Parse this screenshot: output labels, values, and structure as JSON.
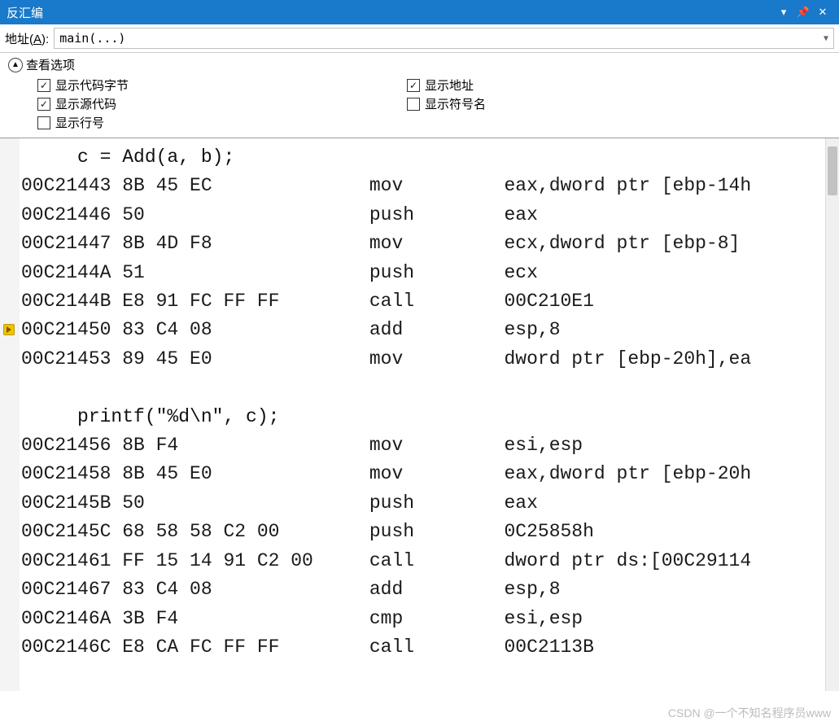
{
  "titlebar": {
    "title": "反汇编",
    "dropdown": "▾",
    "pin": "📌",
    "close": "✕"
  },
  "address_bar": {
    "label_prefix": "地址(",
    "label_accel": "A",
    "label_suffix": "):",
    "value": "main(...)"
  },
  "options": {
    "header": "查看选项",
    "left": [
      {
        "label": "显示代码字节",
        "checked": true
      },
      {
        "label": "显示源代码",
        "checked": true
      },
      {
        "label": "显示行号",
        "checked": false
      }
    ],
    "right": [
      {
        "label": "显示地址",
        "checked": true
      },
      {
        "label": "显示符号名",
        "checked": false
      }
    ]
  },
  "code": {
    "lines": [
      {
        "type": "src",
        "text": "     c = Add(a, b);"
      },
      {
        "type": "asm",
        "addr": "00C21443",
        "bytes": "8B 45 EC",
        "mnem": "mov",
        "ops": "eax,dword ptr [ebp-14h"
      },
      {
        "type": "asm",
        "addr": "00C21446",
        "bytes": "50",
        "mnem": "push",
        "ops": "eax"
      },
      {
        "type": "asm",
        "addr": "00C21447",
        "bytes": "8B 4D F8",
        "mnem": "mov",
        "ops": "ecx,dword ptr [ebp-8]"
      },
      {
        "type": "asm",
        "addr": "00C2144A",
        "bytes": "51",
        "mnem": "push",
        "ops": "ecx"
      },
      {
        "type": "asm",
        "addr": "00C2144B",
        "bytes": "E8 91 FC FF FF",
        "mnem": "call",
        "ops": "00C210E1"
      },
      {
        "type": "asm",
        "addr": "00C21450",
        "bytes": "83 C4 08",
        "mnem": "add",
        "ops": "esp,8",
        "current": true
      },
      {
        "type": "asm",
        "addr": "00C21453",
        "bytes": "89 45 E0",
        "mnem": "mov",
        "ops": "dword ptr [ebp-20h],ea"
      },
      {
        "type": "blank"
      },
      {
        "type": "src",
        "text": "     printf(\"%d\\n\", c);"
      },
      {
        "type": "asm",
        "addr": "00C21456",
        "bytes": "8B F4",
        "mnem": "mov",
        "ops": "esi,esp"
      },
      {
        "type": "asm",
        "addr": "00C21458",
        "bytes": "8B 45 E0",
        "mnem": "mov",
        "ops": "eax,dword ptr [ebp-20h"
      },
      {
        "type": "asm",
        "addr": "00C2145B",
        "bytes": "50",
        "mnem": "push",
        "ops": "eax"
      },
      {
        "type": "asm",
        "addr": "00C2145C",
        "bytes": "68 58 58 C2 00",
        "mnem": "push",
        "ops": "0C25858h"
      },
      {
        "type": "asm",
        "addr": "00C21461",
        "bytes": "FF 15 14 91 C2 00",
        "mnem": "call",
        "ops": "dword ptr ds:[00C29114"
      },
      {
        "type": "asm",
        "addr": "00C21467",
        "bytes": "83 C4 08",
        "mnem": "add",
        "ops": "esp,8"
      },
      {
        "type": "asm",
        "addr": "00C2146A",
        "bytes": "3B F4",
        "mnem": "cmp",
        "ops": "esi,esp"
      },
      {
        "type": "asm",
        "addr": "00C2146C",
        "bytes": "E8 CA FC FF FF",
        "mnem": "call",
        "ops": "00C2113B"
      }
    ]
  },
  "watermark": "CSDN @一个不知名程序员www"
}
